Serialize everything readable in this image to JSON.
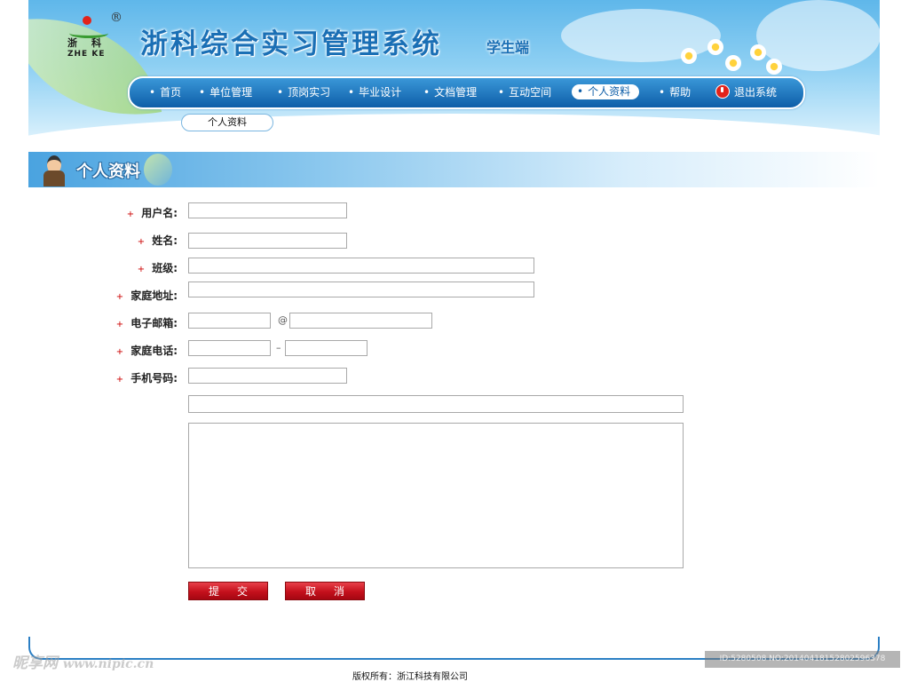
{
  "header": {
    "logo": {
      "reg": "®",
      "cn": "浙科",
      "en": "ZHE KE"
    },
    "title": "浙科综合实习管理系统",
    "subtitle": "学生端"
  },
  "nav": {
    "items": [
      {
        "label": "首页",
        "bullet": "•"
      },
      {
        "label": "单位管理",
        "bullet": "•"
      },
      {
        "label": "顶岗实习",
        "bullet": "•"
      },
      {
        "label": "毕业设计",
        "bullet": "•"
      },
      {
        "label": "文档管理",
        "bullet": "•"
      },
      {
        "label": "互动空间",
        "bullet": "•"
      },
      {
        "label": "个人资料",
        "bullet": "•"
      },
      {
        "label": "帮助",
        "bullet": "•"
      },
      {
        "label": "退出系统",
        "bullet": ""
      }
    ],
    "active": "个人资料",
    "subnav": "个人资料"
  },
  "section": {
    "title": "个人资料"
  },
  "form": {
    "required_mark": "+",
    "username": {
      "label": "用户名:",
      "value": ""
    },
    "name": {
      "label": "姓名:",
      "value": ""
    },
    "class": {
      "label": "班级:",
      "value": ""
    },
    "address": {
      "label": "家庭地址:",
      "value": ""
    },
    "email": {
      "label": "电子邮箱:",
      "user": "",
      "at": "@",
      "domain": ""
    },
    "phone": {
      "label": "家庭电话:",
      "area": "",
      "dash": "–",
      "number": ""
    },
    "mobile": {
      "label": "手机号码:",
      "value": ""
    },
    "extra_line": "",
    "notes": ""
  },
  "buttons": {
    "submit": "提交",
    "cancel": "取消"
  },
  "footer": {
    "copyright": "版权所有：浙江科技有限公司"
  },
  "watermark": {
    "left_cn": "昵享网",
    "left_url": "www.nipic.cn",
    "right_id": "ID:5280508 NO:20140418152802596378"
  },
  "colors": {
    "nav_blue": "#0e5ea8",
    "title_blue": "#1a6fb5",
    "button_red": "#c4101c",
    "required_red": "#cc0000"
  }
}
